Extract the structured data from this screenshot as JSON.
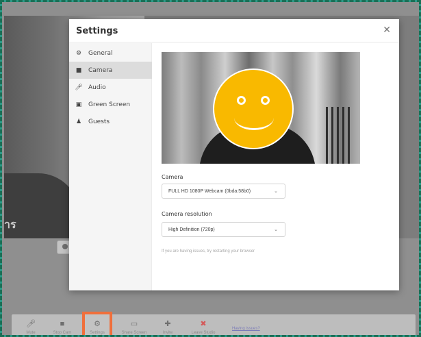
{
  "background": {
    "participant_name_fragment": "าร"
  },
  "toolbar": {
    "items": [
      {
        "label": "Mute",
        "icon": "microphone-icon"
      },
      {
        "label": "Stop Cam",
        "icon": "camera-icon"
      },
      {
        "label": "Settings",
        "icon": "gear-icon"
      },
      {
        "label": "Share Screen",
        "icon": "monitor-icon"
      },
      {
        "label": "Invite",
        "icon": "add-user-icon"
      },
      {
        "label": "Leave Studio",
        "icon": "leave-icon"
      }
    ],
    "link_text": "Having issues?"
  },
  "modal": {
    "title": "Settings",
    "close_glyph": "✕",
    "sidebar": [
      {
        "label": "General",
        "icon": "gear-icon"
      },
      {
        "label": "Camera",
        "icon": "camera-icon",
        "active": true
      },
      {
        "label": "Audio",
        "icon": "microphone-icon"
      },
      {
        "label": "Green Screen",
        "icon": "green-screen-icon"
      },
      {
        "label": "Guests",
        "icon": "person-icon"
      }
    ],
    "camera": {
      "label": "Camera",
      "value": "FULL HD 1080P Webcam (0bda:58b0)"
    },
    "resolution": {
      "label": "Camera resolution",
      "value": "High Definition (720p)"
    },
    "hint": "If you are having issues, try restarting your browser"
  },
  "colors": {
    "highlight": "#f06f3b",
    "frame": "#1a6e55",
    "smiley": "#f9b900"
  }
}
